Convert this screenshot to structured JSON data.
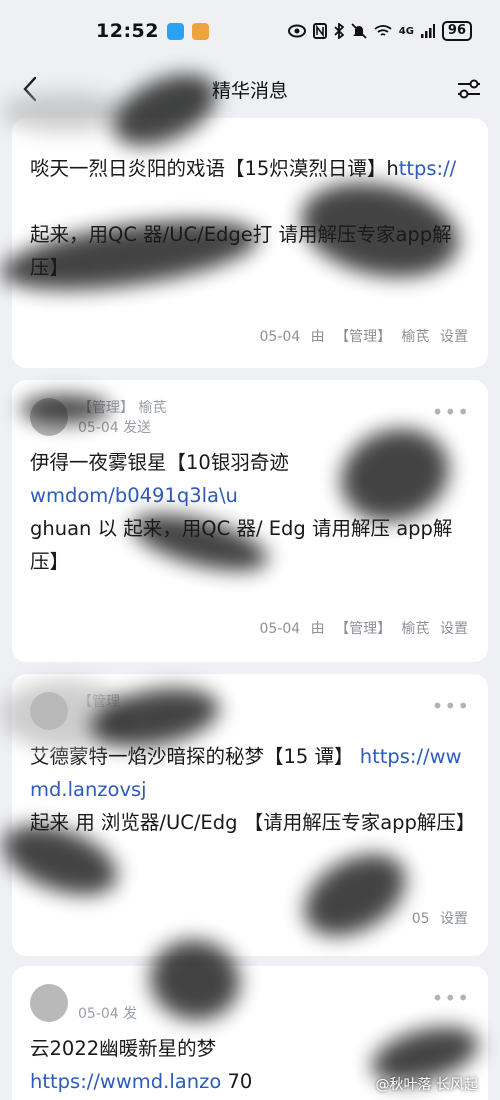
{
  "status_bar": {
    "time": "12:52",
    "signal_label": "4G",
    "battery": "96",
    "icons": [
      "eye-icon",
      "nfc-icon",
      "bluetooth-icon",
      "mute-icon",
      "wifi-icon",
      "signal-icon",
      "battery-icon"
    ]
  },
  "header": {
    "title": "精华消息",
    "back_icon": "chevron-left-icon",
    "filter_icon": "sliders-icon"
  },
  "cards": [
    {
      "text_before_link": "啖天一烈日炎阳的戏语【15炽漠烈日谭】h",
      "link": "ttps://",
      "text_after": "起来，用QC 器/UC/Edge打 请用解压专家app解压】",
      "footer": {
        "date": "05-04",
        "by": "由",
        "role": "【管理】",
        "user": "榆芪",
        "action": "设置"
      }
    },
    {
      "meta_role": "【管理】",
      "meta_user": "榆芪",
      "meta_sent": "05-04 发送",
      "text_before_link": "伊得一夜雾银星【10银羽奇迹",
      "link": "wmd",
      "link_tail": "om/b0491q3la\\u",
      "text_after": "ghuan 以 起来，用QC 器/ Edg 请用解压 app解压】",
      "footer": {
        "date": "05-04",
        "by": "由",
        "role": "【管理】",
        "user": "榆芪",
        "action": "设置"
      }
    },
    {
      "meta_role": "【管理",
      "text_before_link": "艾德蒙特一焰沙暗探的秘梦【15 谭】",
      "link": "https://wwmd.lanzov",
      "link_tail": "sj",
      "text_after": "起来 用 浏览器/UC/Edg 【请用解压专家app解压】",
      "footer": {
        "date": "05",
        "by": "",
        "role": "",
        "user": "",
        "action": "设置"
      }
    },
    {
      "meta_sent": "05-04 发",
      "text_before_link": "云2022幽暖新星的梦",
      "link": "https://wwmd.lanzo",
      "link_tail": "70"
    }
  ],
  "watermark": "@秋叶落 长风起",
  "colors": {
    "background": "#eef0f4",
    "card": "#ffffff",
    "link": "#2d5bb9",
    "meta": "#8c9199"
  }
}
